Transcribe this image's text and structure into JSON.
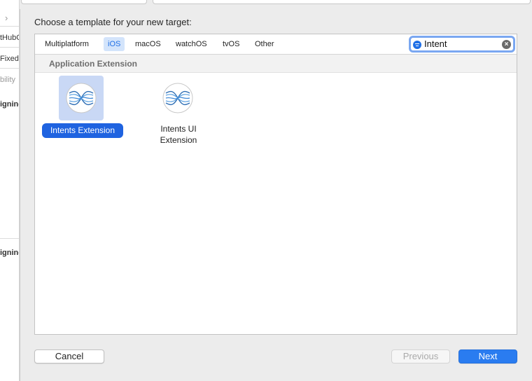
{
  "background_window": {
    "texts": [
      "tHubO",
      "Fixed",
      "bility",
      "igning",
      "igning"
    ]
  },
  "sheet": {
    "title": "Choose a template for your new target:"
  },
  "platform_tabs": [
    {
      "label": "Multiplatform",
      "selected": false
    },
    {
      "label": "iOS",
      "selected": true
    },
    {
      "label": "macOS",
      "selected": false
    },
    {
      "label": "watchOS",
      "selected": false
    },
    {
      "label": "tvOS",
      "selected": false
    },
    {
      "label": "Other",
      "selected": false
    }
  ],
  "search": {
    "value": "Intent",
    "icon": "filter-icon"
  },
  "section": {
    "label": "Application Extension"
  },
  "templates": [
    {
      "label": "Intents Extension",
      "icon": "intents-icon",
      "selected": true
    },
    {
      "label_line1": "Intents UI",
      "label_line2": "Extension",
      "icon": "intents-icon",
      "selected": false
    }
  ],
  "buttons": {
    "cancel": "Cancel",
    "previous": "Previous",
    "next": "Next"
  },
  "colors": {
    "accent": "#1f63e0",
    "selected_tab_text": "#1f6fe6",
    "primary_button": "#2a7cf0"
  }
}
